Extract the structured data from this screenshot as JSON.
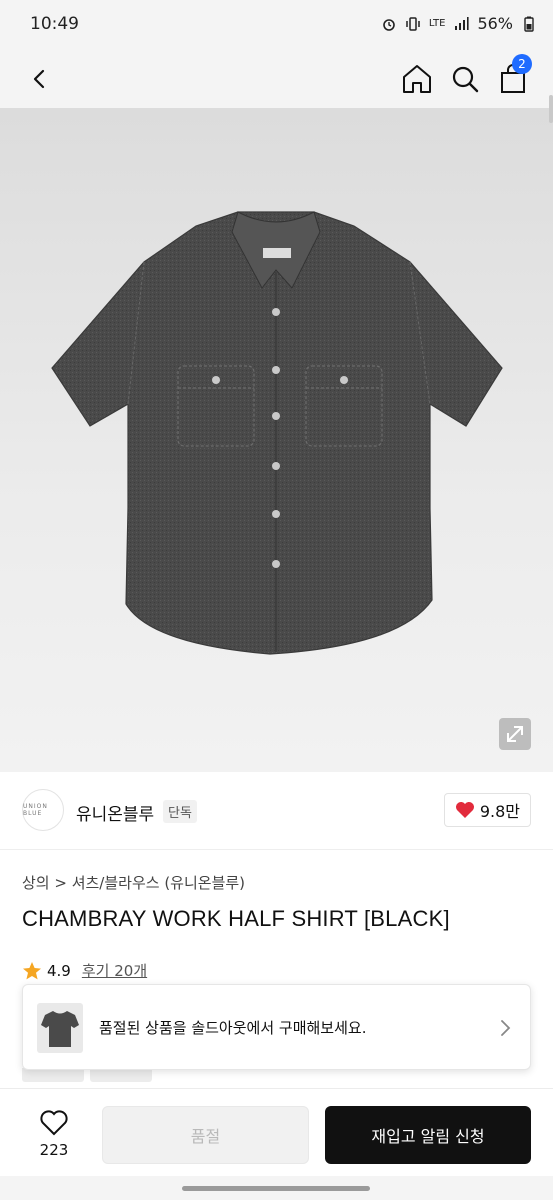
{
  "status_bar": {
    "time": "10:49",
    "network": "LTE",
    "battery": "56%"
  },
  "cart": {
    "count": "2"
  },
  "brand": {
    "logo_text": "UNION BLUE",
    "name": "유니온블루",
    "tag": "단독",
    "likes": "9.8만"
  },
  "product": {
    "breadcrumb": "상의 > 셔츠/블라우스 (유니온블루)",
    "title": "CHAMBRAY WORK HALF SHIRT [BLACK]",
    "rating": "4.9",
    "reviews": "후기 20개"
  },
  "toast": {
    "message": "품절된 상품을 솔드아웃에서 구매해보세요."
  },
  "bottom_bar": {
    "wish_count": "223",
    "soldout_label": "품절",
    "restock_label": "재입고 알림 신청"
  },
  "icons": [
    "back-icon",
    "home-icon",
    "search-icon",
    "cart-icon",
    "expand-icon",
    "heart-icon",
    "star-icon",
    "chevron-right-icon"
  ],
  "colors": {
    "accent_badge": "#1f6bff",
    "heart": "#e22b3c",
    "star": "#f5a623",
    "primary_button": "#111111"
  }
}
